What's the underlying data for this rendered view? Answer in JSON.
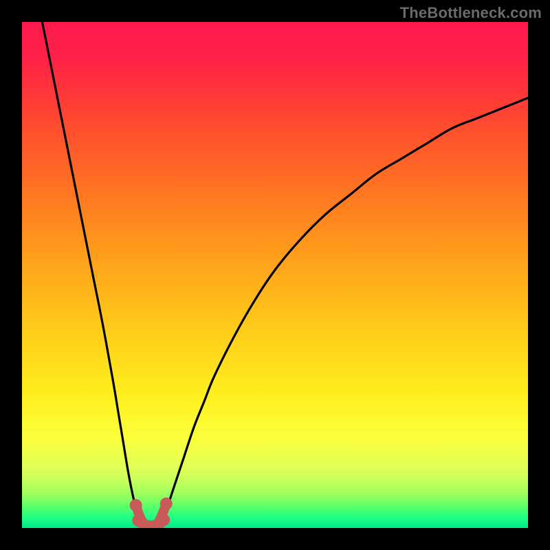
{
  "watermark": "TheBottleneck.com",
  "chart_data": {
    "type": "line",
    "title": "",
    "xlabel": "",
    "ylabel": "",
    "xlim": [
      0,
      100
    ],
    "ylim": [
      0,
      100
    ],
    "grid": false,
    "legend": false,
    "series": [
      {
        "name": "left-branch",
        "x": [
          4,
          6,
          8,
          10,
          12,
          14,
          16,
          18,
          19,
          20,
          21,
          22,
          23,
          24
        ],
        "y": [
          100,
          90,
          80,
          70,
          60,
          50,
          40,
          29,
          23,
          17,
          11,
          6,
          2,
          0
        ]
      },
      {
        "name": "right-branch",
        "x": [
          27,
          28,
          30,
          32,
          34,
          36,
          38,
          42,
          46,
          50,
          55,
          60,
          65,
          70,
          75,
          80,
          85,
          90,
          95,
          100
        ],
        "y": [
          0,
          2,
          8,
          14,
          20,
          25,
          30,
          38,
          45,
          51,
          57,
          62,
          66,
          70,
          73,
          76,
          79,
          81,
          83,
          85
        ]
      },
      {
        "name": "highlight-left",
        "x": [
          22.5,
          23,
          23.5,
          24,
          24.5,
          25
        ],
        "y": [
          4.5,
          3,
          1.8,
          1,
          0.5,
          0.3
        ]
      },
      {
        "name": "highlight-right",
        "x": [
          26,
          26.5,
          27,
          27.5,
          28,
          28.5
        ],
        "y": [
          0.3,
          0.6,
          1.2,
          2.2,
          3.4,
          4.8
        ]
      },
      {
        "name": "highlight-bottom",
        "x": [
          23,
          24,
          25,
          26,
          27,
          28
        ],
        "y": [
          1.5,
          0.5,
          0.2,
          0.2,
          0.5,
          1.6
        ]
      }
    ],
    "gradient_stops": [
      {
        "offset": 0.0,
        "color": "#ff1a4d"
      },
      {
        "offset": 0.07,
        "color": "#ff2047"
      },
      {
        "offset": 0.2,
        "color": "#ff4a2f"
      },
      {
        "offset": 0.35,
        "color": "#ff7a20"
      },
      {
        "offset": 0.5,
        "color": "#ffab1a"
      },
      {
        "offset": 0.63,
        "color": "#ffd21a"
      },
      {
        "offset": 0.74,
        "color": "#fff01f"
      },
      {
        "offset": 0.82,
        "color": "#fcff3a"
      },
      {
        "offset": 0.875,
        "color": "#e4ff55"
      },
      {
        "offset": 0.905,
        "color": "#c8ff5a"
      },
      {
        "offset": 0.928,
        "color": "#a6ff5e"
      },
      {
        "offset": 0.946,
        "color": "#7dff62"
      },
      {
        "offset": 0.962,
        "color": "#4eff6e"
      },
      {
        "offset": 0.98,
        "color": "#1dff84"
      },
      {
        "offset": 1.0,
        "color": "#00e887"
      }
    ],
    "curve_color": "#000000",
    "highlight_color": "#c85a5a"
  }
}
